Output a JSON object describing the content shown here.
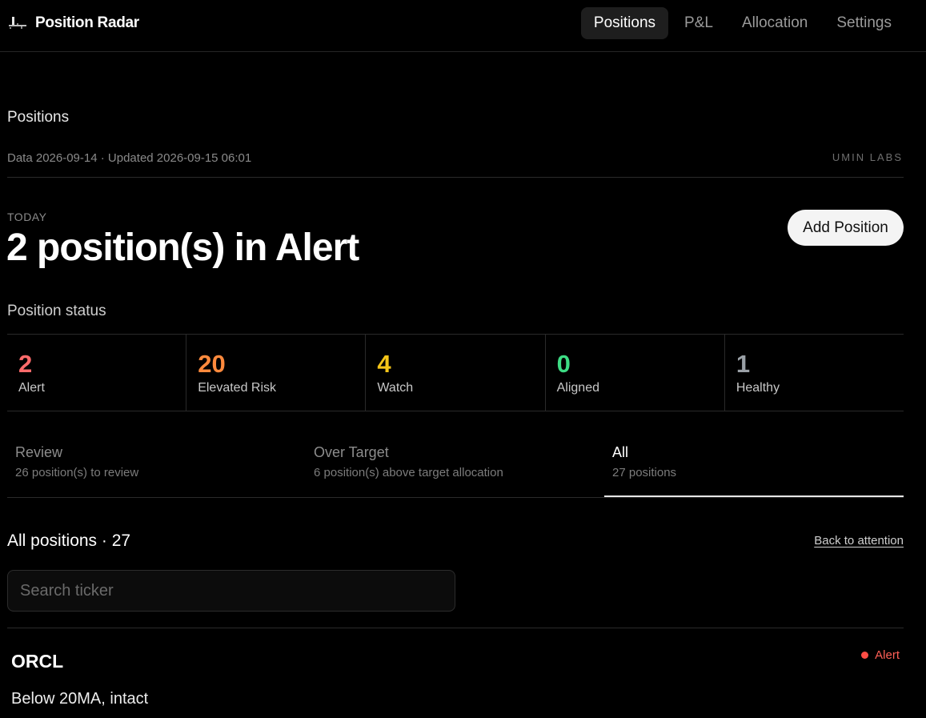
{
  "app": {
    "name": "Position Radar",
    "icon": "radar-logo-icon"
  },
  "nav": {
    "items": [
      {
        "label": "Positions",
        "active": true
      },
      {
        "label": "P&L",
        "active": false
      },
      {
        "label": "Allocation",
        "active": false
      },
      {
        "label": "Settings",
        "active": false
      }
    ]
  },
  "page": {
    "title": "Positions",
    "meta": "Data 2026-09-14 · Updated 2026-09-15 06:01",
    "org": "UMIN LABS"
  },
  "summary": {
    "eyebrow": "TODAY",
    "headline": "2 position(s) in Alert",
    "add_button": "Add Position"
  },
  "status": {
    "title": "Position status",
    "cells": [
      {
        "count": "2",
        "label": "Alert",
        "color": "#ff6b6b"
      },
      {
        "count": "20",
        "label": "Elevated Risk",
        "color": "#ff8a3d"
      },
      {
        "count": "4",
        "label": "Watch",
        "color": "#f5c518"
      },
      {
        "count": "0",
        "label": "Aligned",
        "color": "#3ddc84"
      },
      {
        "count": "1",
        "label": "Healthy",
        "color": "#9aa0a6"
      }
    ]
  },
  "tabs": [
    {
      "title": "Review",
      "sub": "26 position(s) to review",
      "active": false
    },
    {
      "title": "Over Target",
      "sub": "6 position(s) above target allocation",
      "active": false
    },
    {
      "title": "All",
      "sub": "27 positions",
      "active": true
    }
  ],
  "list": {
    "title": "All positions · 27",
    "back_link": "Back to attention",
    "search_placeholder": "Search ticker",
    "search_value": "",
    "rows": [
      {
        "ticker": "ORCL",
        "status": "Alert",
        "status_color": "#ff4d45",
        "note": "Below 20MA, intact"
      }
    ]
  }
}
